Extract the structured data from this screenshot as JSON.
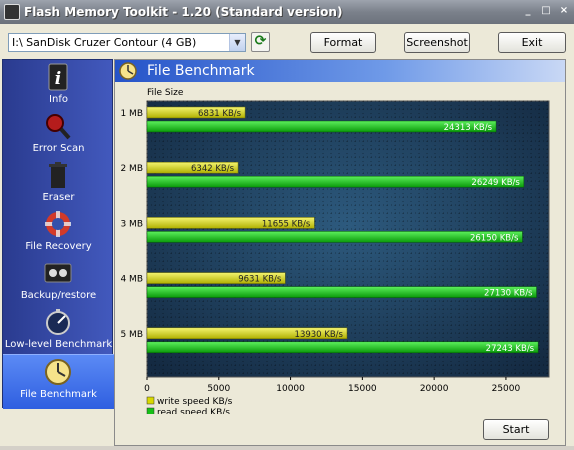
{
  "window": {
    "title": "Flash Memory Toolkit - 1.20 (Standard version)",
    "min_label": "_",
    "max_label": "□",
    "close_label": "×"
  },
  "toolbar": {
    "device": "I:\\ SanDisk Cruzer Contour (4 GB)",
    "format_label": "Format",
    "screenshot_label": "Screenshot",
    "exit_label": "Exit",
    "refresh_icon": "refresh-icon",
    "refresh_glyph": "⟳"
  },
  "sidebar": {
    "items": [
      {
        "label": "Info",
        "icon": "info-icon",
        "active": false
      },
      {
        "label": "Error Scan",
        "icon": "magnifier-icon",
        "active": false
      },
      {
        "label": "Eraser",
        "icon": "trash-icon",
        "active": false
      },
      {
        "label": "File Recovery",
        "icon": "lifebuoy-icon",
        "active": false
      },
      {
        "label": "Backup/restore",
        "icon": "tape-icon",
        "active": false
      },
      {
        "label": "Low-level Benchmark",
        "icon": "stopwatch-icon",
        "active": false
      },
      {
        "label": "File Benchmark",
        "icon": "clock-icon",
        "active": true
      }
    ]
  },
  "panel": {
    "title": "File Benchmark",
    "start_label": "Start"
  },
  "chart_data": {
    "type": "bar",
    "orientation": "horizontal",
    "categories": [
      "1 MB",
      "2 MB",
      "3 MB",
      "4 MB",
      "5 MB"
    ],
    "series": [
      {
        "name": "write speed KB/s",
        "values": [
          6831,
          6342,
          11655,
          9631,
          13930
        ],
        "labels": [
          "6831 KB/s",
          "6342 KB/s",
          "11655 KB/s",
          "9631 KB/s",
          "13930 KB/s"
        ],
        "color": "#d8d800"
      },
      {
        "name": "read speed KB/s",
        "values": [
          24313,
          26249,
          26150,
          27130,
          27243
        ],
        "labels": [
          "24313 KB/s",
          "26249 KB/s",
          "26150 KB/s",
          "27130 KB/s",
          "27243 KB/s"
        ],
        "color": "#16c016"
      }
    ],
    "ylabel": "File Size",
    "xlim": [
      0,
      28000
    ],
    "xticks": [
      0,
      5000,
      10000,
      15000,
      20000,
      25000
    ],
    "grid": true,
    "legend_position": "bottom-left",
    "background": "#1a3450"
  }
}
